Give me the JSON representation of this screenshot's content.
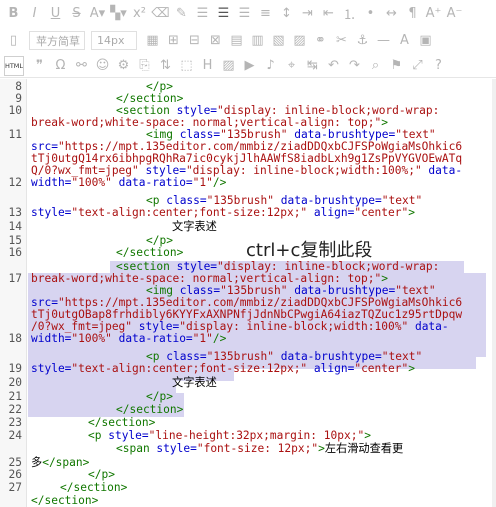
{
  "toolbar": {
    "font_family_value": "苹方简草",
    "font_size_value": "14px",
    "html_button_label": "HTML"
  },
  "editor": {
    "lines": [
      {
        "n": "8"
      },
      {
        "n": "9"
      },
      {
        "n": "10"
      },
      {
        "n": ""
      },
      {
        "n": "11"
      },
      {
        "n": ""
      },
      {
        "n": ""
      },
      {
        "n": ""
      },
      {
        "n": "12"
      },
      {
        "n": ""
      },
      {
        "n": "13"
      },
      {
        "n": "14"
      },
      {
        "n": "15"
      },
      {
        "n": "16"
      },
      {
        "n": ""
      },
      {
        "n": "17"
      },
      {
        "n": ""
      },
      {
        "n": ""
      },
      {
        "n": ""
      },
      {
        "n": ""
      },
      {
        "n": "18"
      },
      {
        "n": ""
      },
      {
        "n": "19"
      },
      {
        "n": "20"
      },
      {
        "n": "21"
      },
      {
        "n": "22"
      },
      {
        "n": "23"
      },
      {
        "n": "24"
      },
      {
        "n": ""
      },
      {
        "n": "25"
      },
      {
        "n": "26"
      },
      {
        "n": "27"
      }
    ],
    "s": {
      "l0a": "</p>",
      "l1a": "</section>",
      "l2a": "<section ",
      "l2b": "style=",
      "l2c": "\"display: inline-block;word-wrap:",
      "l3a": "break-word;white-space: normal;vertical-align: top;\"",
      "l3b": ">",
      "l4a": "<img ",
      "l4b": "class=",
      "l4c": "\"135brush\" ",
      "l4d": "data-brushtype=",
      "l4e": "\"text\"",
      "l5a": "src=",
      "l5b": "\"https://mpt.135editor.com/mmbiz/ziadDDQxbCJFSPoWgiaMsOhkic6",
      "l6a": "tTj0utgQ14rx6ibhpgRQhRa7ic0cykjJlhAAWfS8iadbLxh9g1ZsPpVYGVOEwATq",
      "l7a": "Q/0?wx_fmt=jpeg\" ",
      "l7b": "style=",
      "l7c": "\"display: inline-block;width:100%;\" ",
      "l7d": "data-",
      "l8a": "width=",
      "l8b": "\"100%\" ",
      "l8c": "data-ratio=",
      "l8d": "\"1\"",
      "l8e": "/>",
      "l9a": "<p ",
      "l9b": "class=",
      "l9c": "\"135brush\" ",
      "l9d": "data-brushtype=",
      "l9e": "\"text\"",
      "l10a": "style=",
      "l10b": "\"text-align:center;font-size:12px;\" ",
      "l10c": "align=",
      "l10d": "\"center\"",
      "l10e": ">",
      "l11a": "文字表述",
      "l12a": "</p>",
      "l13a": "</section>",
      "l14a": "<section ",
      "l14b": "style=",
      "l14c": "\"display: inline-block;word-wrap:",
      "l15a": "break-word;white-space: normal;vertical-align: top;\"",
      "l15b": ">",
      "l16a": "<img ",
      "l16b": "class=",
      "l16c": "\"135brush\" ",
      "l16d": "data-brushtype=",
      "l16e": "\"text\"",
      "l17a": "src=",
      "l17b": "\"https://mpt.135editor.com/mmbiz/ziadDDQxbCJFSPoWgiaMsOhkic6",
      "l18a": "tTj0utgOBap8frhdibly6KYYFxAXNPNfjJdnNbCPwgiA64iazTQZuc1z95rtDpqw",
      "l19a": "/0?wx_fmt=jpeg\" ",
      "l19b": "style=",
      "l19c": "\"display: inline-block;width:100%\" ",
      "l19d": "data-",
      "l20a": "width=",
      "l20b": "\"100%\" ",
      "l20c": "data-ratio=",
      "l20d": "\"1\"",
      "l20e": "/>",
      "l21a": "<p ",
      "l21b": "class=",
      "l21c": "\"135brush\" ",
      "l21d": "data-brushtype=",
      "l21e": "\"text\"",
      "l22a": "style=",
      "l22b": "\"text-align:center;font-size:12px;\" ",
      "l22c": "align=",
      "l22d": "\"center\"",
      "l22e": ">",
      "l23a": "文字表述",
      "l24a": "</p>",
      "l25a": "</section>",
      "l26a": "</section>",
      "l27a": "<p ",
      "l27b": "style=",
      "l27c": "\"line-height:32px;margin: 10px;\"",
      "l27d": ">",
      "l28a": "<span ",
      "l28b": "style=",
      "l28c": "\"font-size: 12px;\"",
      "l28d": ">",
      "l28e": "左右滑动查看更",
      "l29a": "多",
      "l29b": "</span>",
      "l30a": "</p>",
      "l31a": "</section>",
      "l32a": "</section>"
    }
  },
  "overlay_text": "ctrl+c复制此段"
}
